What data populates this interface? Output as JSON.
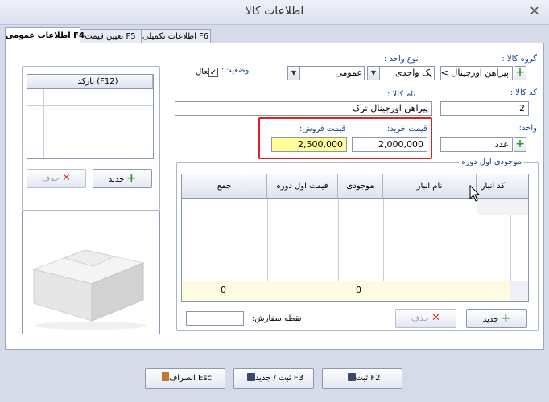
{
  "window": {
    "title": "اطلاعات كالا",
    "close_glyph": "✕"
  },
  "tabs": [
    {
      "label": "اطلاعات عمومی F4",
      "active": true
    },
    {
      "label": "تعیین قیمت F5",
      "active": false
    },
    {
      "label": "اطلاعات تكمیلی F6",
      "active": false
    }
  ],
  "form": {
    "group": {
      "label": "گروه کالا :",
      "value": "پیراهن اورجینال > پی"
    },
    "unit_type": {
      "label": "نوع واحد :",
      "value1": "یک واحدی",
      "value2": "عمومی"
    },
    "status": {
      "label": "وضعیت:",
      "checkbox_label": "فعال",
      "checked": true
    },
    "code": {
      "label": "کد کالا :",
      "value": "2"
    },
    "name": {
      "label": "نام کالا :",
      "value": "پیراهن اورجینال ترک"
    },
    "unit": {
      "label": "واحد:",
      "value": "عدد"
    },
    "purchase_price": {
      "label": "قیمت خرید:",
      "value": "2,000,000"
    },
    "sale_price": {
      "label": "قیمت فروش:",
      "value": "2,500,000"
    }
  },
  "barcode": {
    "header": "(F12) بارکد",
    "new_label": "جدید",
    "delete_label": "حذف"
  },
  "stock": {
    "group_title": "موجودی اول دوره",
    "columns": [
      "کد انبار",
      "نام انبار",
      "موجودی",
      "قیمت اول دوره",
      "جمع"
    ],
    "totals": {
      "quantity": "0",
      "sum": "0"
    },
    "new_label": "جدید",
    "delete_label": "حذف",
    "reorder_label": "نقطه سفارش:"
  },
  "footer": {
    "save_label": "ثبت F2",
    "save_new_label": "ثبت / جدید F3",
    "cancel_label": "انصراف Esc"
  },
  "colors": {
    "highlight": "#e02020",
    "sale_field_bg": "#ffff99",
    "accent": "#15428b"
  }
}
